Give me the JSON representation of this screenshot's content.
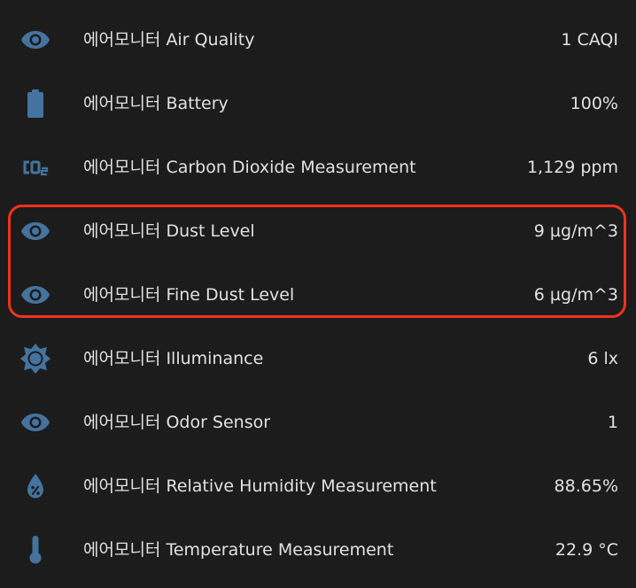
{
  "colors": {
    "background": "#1c1c1c",
    "text": "#e1e1e1",
    "icon": "#44739e",
    "highlight": "#f0321e"
  },
  "entities": [
    {
      "icon": "eye-icon",
      "label": "에어모니터 Air Quality",
      "value": "1 CAQI"
    },
    {
      "icon": "battery-icon",
      "label": "에어모니터 Battery",
      "value": "100%"
    },
    {
      "icon": "co2-icon",
      "label": "에어모니터 Carbon Dioxide Measurement",
      "value": "1,129 ppm"
    },
    {
      "icon": "eye-icon",
      "label": "에어모니터 Dust Level",
      "value": "9 µg/m^3"
    },
    {
      "icon": "eye-icon",
      "label": "에어모니터 Fine Dust Level",
      "value": "6 µg/m^3"
    },
    {
      "icon": "brightness-icon",
      "label": "에어모니터 Illuminance",
      "value": "6 lx"
    },
    {
      "icon": "eye-icon",
      "label": "에어모니터 Odor Sensor",
      "value": "1"
    },
    {
      "icon": "water-percent-icon",
      "label": "에어모니터 Relative Humidity Measurement",
      "value": "88.65%"
    },
    {
      "icon": "thermometer-icon",
      "label": "에어모니터 Temperature Measurement",
      "value": "22.9 °C"
    }
  ]
}
